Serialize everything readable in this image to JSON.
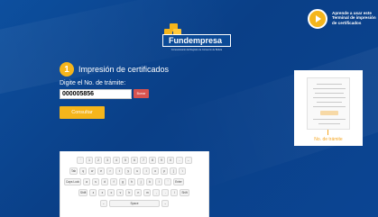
{
  "brand": {
    "name": "Fundempresa",
    "tagline": "Concesionario del Registro de Comercio de Bolivia"
  },
  "help": {
    "text_line1": "Aprende a usar este",
    "text_line2": "Terminal de impresión",
    "text_line3": "de certificados",
    "icon": "play-icon"
  },
  "step": {
    "number": "1",
    "title": "Impresión de certificados"
  },
  "form": {
    "label": "Digite el No. de trámite:",
    "value": "000005856",
    "erase_label": "Borrar",
    "submit_label": "Consultar"
  },
  "receipt": {
    "caption": "No. de trámite"
  },
  "keyboard": {
    "row1": [
      "'",
      "1",
      "2",
      "3",
      "4",
      "5",
      "6",
      "7",
      "8",
      "9",
      "0",
      "-",
      "←"
    ],
    "row2": [
      "Tab",
      "q",
      "w",
      "e",
      "r",
      "t",
      "y",
      "u",
      "i",
      "o",
      "p",
      "[",
      "\\"
    ],
    "row3": [
      "Caps Lock",
      "a",
      "s",
      "d",
      "f",
      "g",
      "h",
      "j",
      "k",
      "l",
      "'",
      "Enter"
    ],
    "row4": [
      "Shift",
      "z",
      "x",
      "c",
      "v",
      "b",
      "n",
      "m",
      ",",
      ".",
      "/",
      "Shift"
    ],
    "row5": [
      "←",
      "Space",
      "→"
    ]
  },
  "colors": {
    "background": "#0b4593",
    "accent": "#f5b51b",
    "danger": "#d9534f",
    "caption": "#f5a623"
  }
}
